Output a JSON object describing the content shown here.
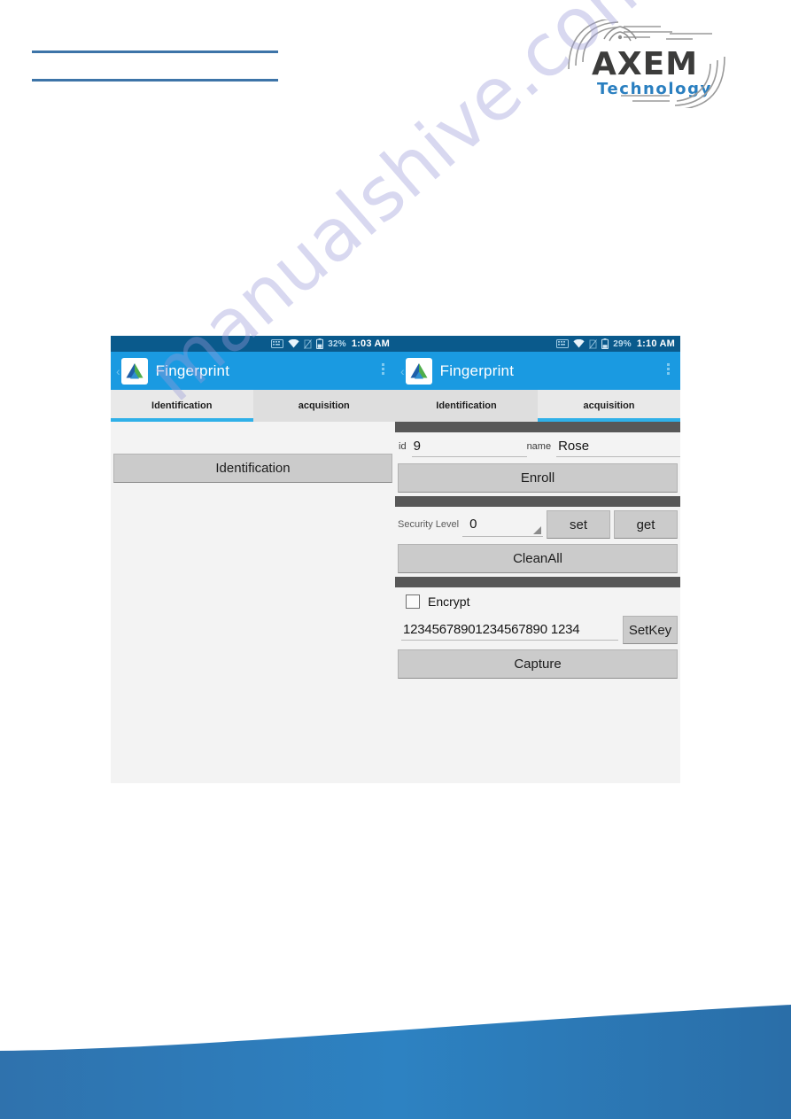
{
  "page": {
    "brand": {
      "name_main": "AXEM",
      "name_sub": "Technology",
      "main_color": "#3c3c3b",
      "sub_color": "#2a7fc0"
    },
    "rule_color": "#3d74a8",
    "footer_color": "#2877b8"
  },
  "watermark": {
    "text": "manualshive.com",
    "color": "#9a9bd8"
  },
  "screenshots": [
    {
      "id": "left",
      "status_bar": {
        "battery_percent": "32%",
        "time": "1:03 AM",
        "icons": [
          "keyboard-icon",
          "wifi-icon",
          "sim-off-icon",
          "battery-icon"
        ]
      },
      "action_bar": {
        "back_label": "‹",
        "title": "Fingerprint",
        "app_icon": "fingerprint-app-icon",
        "overflow": "overflow-menu-icon"
      },
      "tabs": [
        {
          "label": "Identification",
          "active": true
        },
        {
          "label": "acquisition",
          "active": false
        }
      ],
      "buttons": [
        {
          "label": "Identification"
        }
      ]
    },
    {
      "id": "right",
      "status_bar": {
        "battery_percent": "29%",
        "time": "1:10 AM",
        "icons": [
          "keyboard-icon",
          "wifi-icon",
          "sim-off-icon",
          "battery-icon"
        ]
      },
      "action_bar": {
        "back_label": "‹",
        "title": "Fingerprint",
        "app_icon": "fingerprint-app-icon",
        "overflow": "overflow-menu-icon"
      },
      "tabs": [
        {
          "label": "Identification",
          "active": false
        },
        {
          "label": "acquisition",
          "active": true
        }
      ],
      "form": {
        "id_label": "id",
        "id_value": "9",
        "name_label": "name",
        "name_value": "Rose",
        "enroll_label": "Enroll",
        "security_label": "Security Level",
        "security_value": "0",
        "set_label": "set",
        "get_label": "get",
        "cleanall_label": "CleanAll",
        "encrypt_label": "Encrypt",
        "encrypt_checked": false,
        "key_value": "12345678901234567890 1234",
        "key_value_display": "12345678901234567890 1234",
        "setkey_label": "SetKey",
        "capture_label": "Capture"
      }
    }
  ]
}
